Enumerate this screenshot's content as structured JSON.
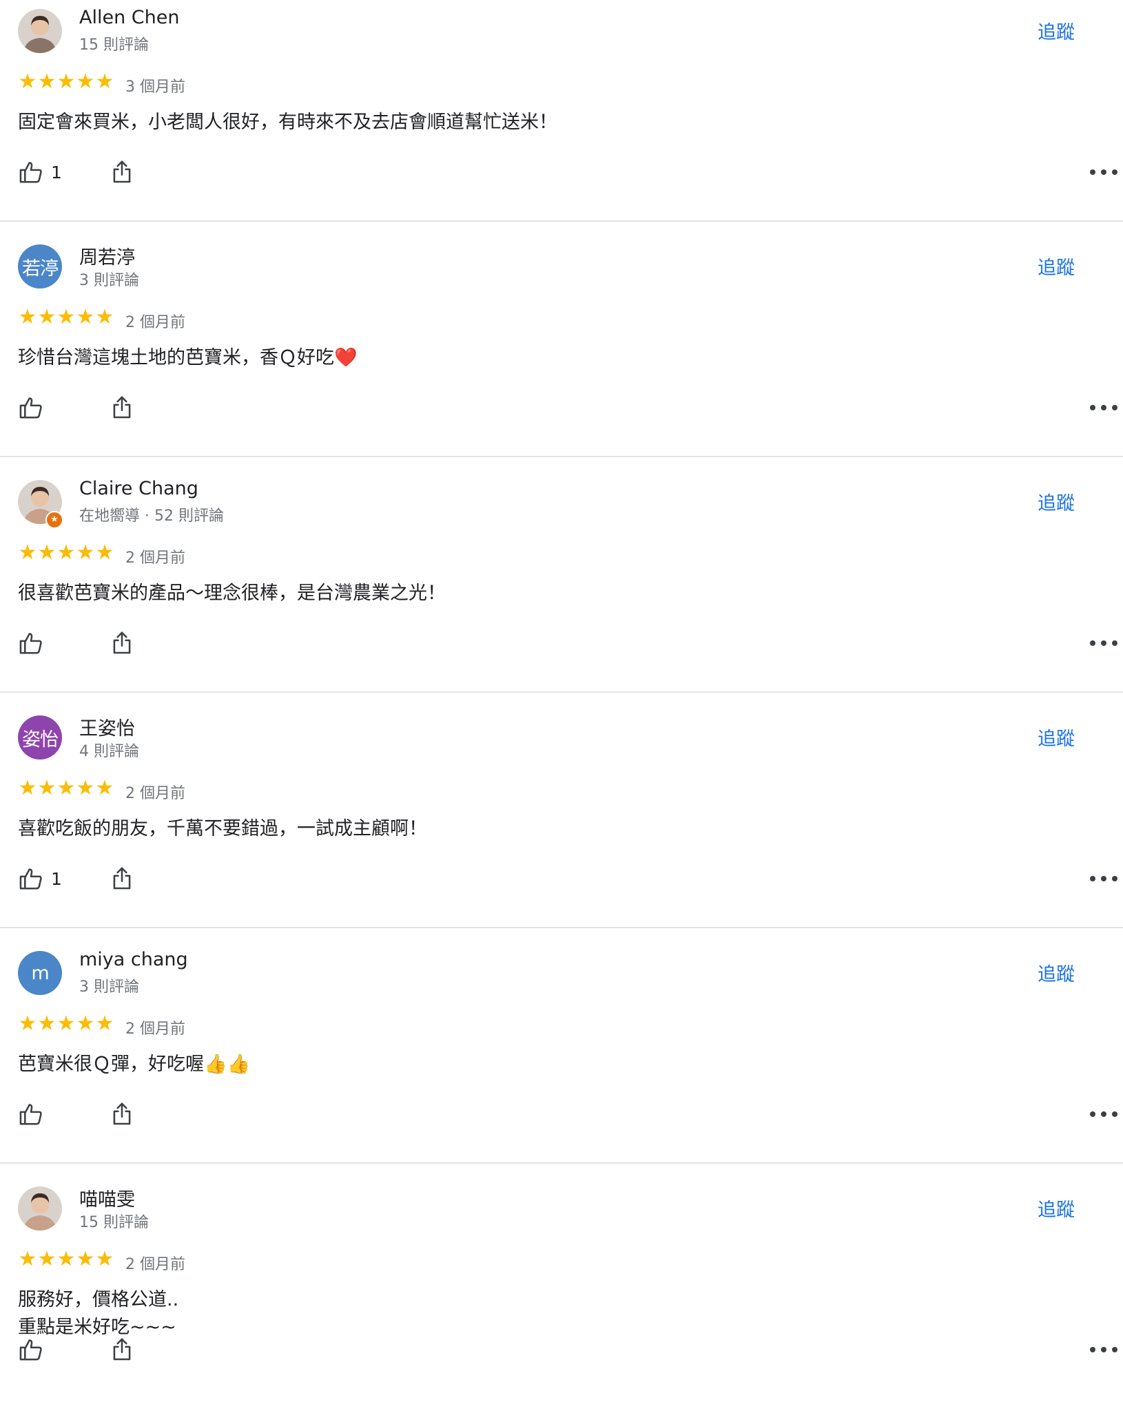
{
  "follow_label": "追蹤",
  "colors": {
    "accent": "#1a73e8",
    "star": "#fbbc04"
  },
  "reviews": [
    {
      "name": "Allen Chen",
      "meta": "15 則評論",
      "avatar": {
        "type": "photo",
        "icon": "user-photo"
      },
      "rating": 5,
      "time": "3 個月前",
      "text": "固定會來買米，小老闆人很好，有時來不及去店會順道幫忙送米！",
      "likes": "1"
    },
    {
      "name": "周若渟",
      "meta": "3 則評論",
      "avatar": {
        "type": "initials",
        "initials": "若渟",
        "color": "#4a86c8"
      },
      "rating": 5,
      "time": "2 個月前",
      "text": "珍惜台灣這塊土地的芭寶米，香Ｑ好吃❤️",
      "likes": ""
    },
    {
      "name": "Claire Chang",
      "meta": "在地嚮導 · 52 則評論",
      "avatar": {
        "type": "photo",
        "icon": "user-photo",
        "badge": "★"
      },
      "rating": 5,
      "time": "2 個月前",
      "text": "很喜歡芭寶米的產品～理念很棒，是台灣農業之光！",
      "likes": ""
    },
    {
      "name": "王姿怡",
      "meta": "4 則評論",
      "avatar": {
        "type": "initials",
        "initials": "姿怡",
        "color": "#8e44ad"
      },
      "rating": 5,
      "time": "2 個月前",
      "text": "喜歡吃飯的朋友，千萬不要錯過，一試成主顧啊！",
      "likes": "1"
    },
    {
      "name": "miya chang",
      "meta": "3 則評論",
      "avatar": {
        "type": "initials",
        "initials": "m",
        "color": "#4a86c8"
      },
      "rating": 5,
      "time": "2 個月前",
      "text": "芭寶米很Ｑ彈，好吃喔👍👍",
      "likes": ""
    },
    {
      "name": "喵喵雯",
      "meta": "15 則評論",
      "avatar": {
        "type": "photo",
        "icon": "user-photo"
      },
      "rating": 5,
      "time": "2 個月前",
      "text": "服務好，價格公道..\n重點是米好吃~~~",
      "likes": ""
    }
  ]
}
